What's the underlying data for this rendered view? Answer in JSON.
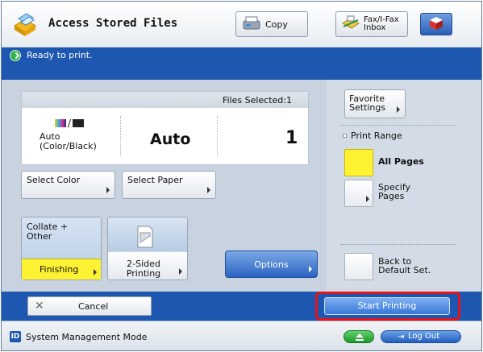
{
  "header": {
    "title": "Access Stored Files",
    "copy_label": "Copy",
    "fax_label_line1": "Fax/I-Fax",
    "fax_label_line2": "Inbox"
  },
  "status": {
    "message": "Ready to print."
  },
  "summary": {
    "files_selected": "Files Selected:1",
    "color_mode_line1": "Auto",
    "color_mode_line2": "(Color/Black)",
    "paper": "Auto",
    "copies": "1"
  },
  "settings": {
    "select_color": "Select Color",
    "select_paper": "Select Paper",
    "collate_line1": "Collate +",
    "collate_line2": "Other",
    "finishing": "Finishing",
    "two_sided_line1": "2-Sided",
    "two_sided_line2": "Printing",
    "options": "Options"
  },
  "right_panel": {
    "favorite_line1": "Favorite",
    "favorite_line2": "Settings",
    "print_range": "Print Range",
    "all_pages": "All Pages",
    "specify_line1": "Specify",
    "specify_line2": "Pages",
    "selected_range": "All Pages",
    "back_line1": "Back to",
    "back_line2": "Default Set."
  },
  "action_bar": {
    "cancel": "Cancel",
    "start": "Start Printing"
  },
  "footer": {
    "id_badge": "ID",
    "system_management": "System Management Mode",
    "log_out": "Log Out"
  },
  "colors": {
    "accent_blue": "#1e57b0",
    "highlight_yellow": "#fff233",
    "highlight_red": "#e3141c"
  }
}
